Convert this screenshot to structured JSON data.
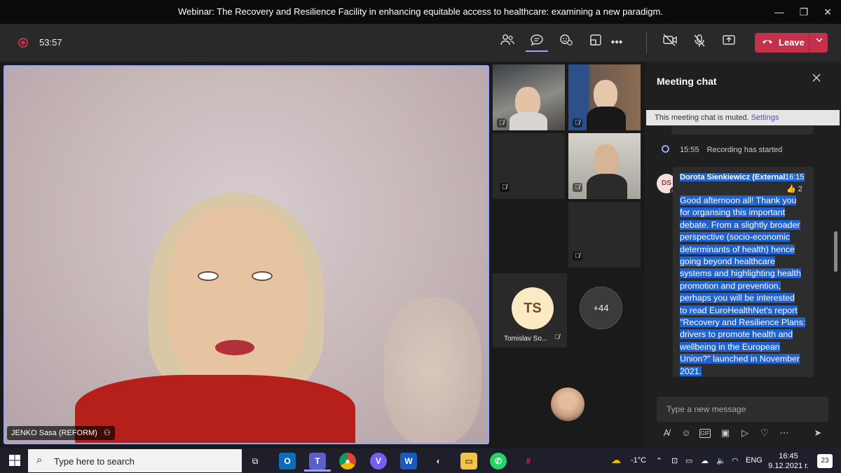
{
  "window": {
    "title": "Webinar: The Recovery and Resilience Facility in enhancing equitable access to healthcare: examining a new paradigm.",
    "minimize": "—",
    "maximize": "❐",
    "close": "✕"
  },
  "toolbar": {
    "timer": "53:57",
    "leave_label": "Leave",
    "more": "•••",
    "accent": "#c4314b"
  },
  "stage": {
    "main_participant": "JENKO Sasa (REFORM)",
    "tiles": [
      {
        "initials": "TS",
        "name": "Tomislav So..."
      },
      {
        "label": "+44"
      }
    ]
  },
  "chat": {
    "title": "Meeting chat",
    "muted_text": "This meeting chat is muted.",
    "muted_link": "Settings",
    "recording_time": "15:55",
    "recording_text": "Recording has started",
    "message": {
      "avatar": "DS",
      "author": "Dorota Sienkiewicz (External)",
      "time": "16:15",
      "reaction_count": "2",
      "body_lines": [
        "Good afternoon all! Thank you",
        "for organsing this important",
        "debate. From a slightly broader",
        "perspective (socio-economic",
        "determinants of health) hence",
        "going beyond healthcare",
        "systems and highlighting health",
        "promotion and prevention,",
        "perhaps you will be interested",
        "to read EuroHealthNet's report",
        "\"Recovery and Resilience Plans:",
        "drivers to promote health and",
        "wellbeing in the European",
        "Union?\" launched in November",
        "2021."
      ]
    },
    "composer_placeholder": "Type a new message"
  },
  "taskbar": {
    "search_placeholder": "Type here to search",
    "temperature": "-1°C",
    "language": "ENG",
    "time": "16:45",
    "date": "9.12.2021 г.",
    "notifications": "23"
  }
}
